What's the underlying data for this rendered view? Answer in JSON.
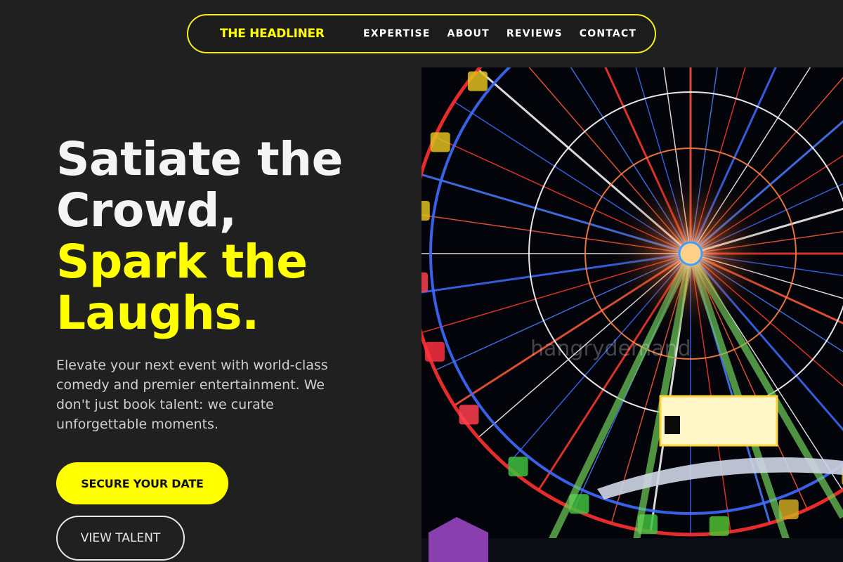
{
  "nav": {
    "brand": "THE HEADLINER",
    "links": [
      "EXPERTISE",
      "ABOUT",
      "REVIEWS",
      "CONTACT"
    ]
  },
  "hero": {
    "headline_white": [
      "Satiate the",
      "Crowd,"
    ],
    "headline_yellow": [
      "Spark the",
      "Laughs."
    ],
    "description": "Elevate your next event with world-class comedy and premier entertainment. We don't just book talent: we curate unforgettable moments.",
    "primary_button": "SECURE YOUR DATE",
    "secondary_button": "VIEW TALENT"
  },
  "image": {
    "subject": "ferris-wheel-night",
    "watermark": "hangrydemand"
  },
  "colors": {
    "accent": "#ffff00",
    "background": "#202020",
    "text": "#f4f4f4"
  }
}
